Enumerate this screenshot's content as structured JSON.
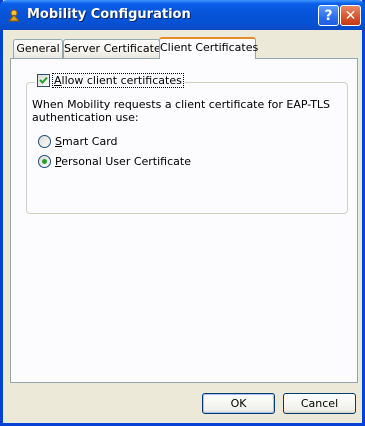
{
  "window": {
    "title": "Mobility Configuration",
    "help_glyph": "?",
    "close_glyph": "✕",
    "accent": "#0753d8"
  },
  "tabs": [
    {
      "label": "General",
      "active": false
    },
    {
      "label": "Server Certificates",
      "active": false
    },
    {
      "label": "Client Certificates",
      "active": true
    }
  ],
  "client_certs": {
    "allow_checkbox": {
      "label_first": "A",
      "label_rest": "llow client certificates",
      "checked": true
    },
    "description": "When Mobility requests a client certificate for EAP-TLS authentication use:",
    "options": [
      {
        "label_first": "S",
        "label_rest": "mart Card",
        "selected": false
      },
      {
        "label_first": "P",
        "label_rest": "ersonal User Certificate",
        "selected": true
      }
    ]
  },
  "buttons": {
    "ok": "OK",
    "cancel": "Cancel"
  }
}
